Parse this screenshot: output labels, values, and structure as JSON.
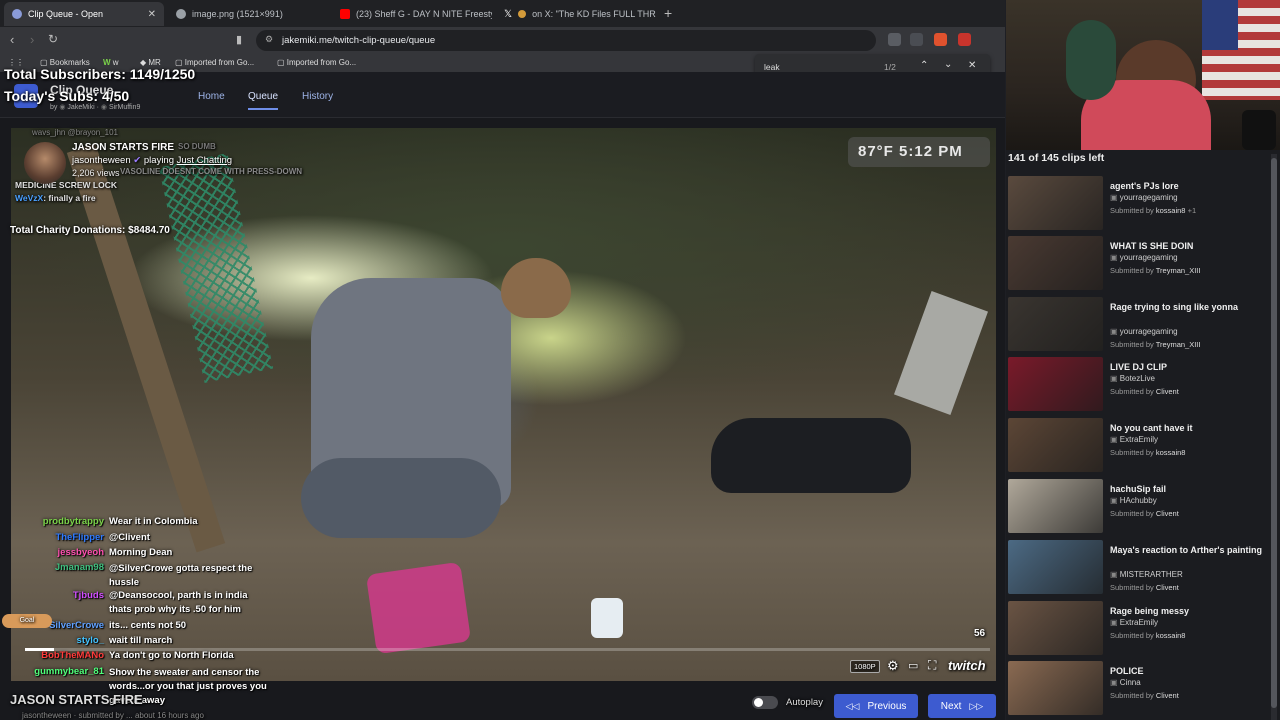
{
  "browser": {
    "tabs": [
      {
        "label": "Clip Queue - Open",
        "active": true
      },
      {
        "label": "image.png (1521×991)",
        "active": false
      },
      {
        "label": "(23) Sheff G - DAY N NITE Freestyle (",
        "active": false
      },
      {
        "label": "on X: \"The KD Files FULL THREAD",
        "active": false
      }
    ],
    "new_tab": "+",
    "url": "jakemiki.me/twitch-clip-queue/queue",
    "bookmarks": [
      "Bookmarks",
      "w",
      "MR",
      "Imported from Go...",
      "Imported from Go..."
    ],
    "find": {
      "query": "leak",
      "count": "1/2"
    }
  },
  "site": {
    "title": "Clip Queue",
    "by": "by",
    "author1": "JakeMiki",
    "author2": "SirMuffin9",
    "nav": [
      "Home",
      "Queue",
      "History"
    ],
    "active_nav": "Queue"
  },
  "stream_overlay": {
    "subs_total": "Total Subscribers: 1149/1250",
    "subs_today": "Today's Subs: 4/50",
    "weather": "87°F  5:12 PM",
    "charity": "Total Charity Donations: $8484.70",
    "top_chat": [
      {
        "user": "wavs_jhn",
        "text": "@brayon_101"
      },
      {
        "user": "",
        "text": "SO DUMB"
      },
      {
        "user": "",
        "text": "VASOLINE DOESNT COME WITH PRESS-DOWN"
      },
      {
        "user": "",
        "text": "MEDICINE SCREW LOCK"
      },
      {
        "user": "WeVzX",
        "text": "finally a fire"
      }
    ],
    "goal": "Goal"
  },
  "clip": {
    "title": "JASON STARTS FIRE",
    "channel": "jasontheween",
    "playing": "playing",
    "category": "Just Chatting",
    "views": "2,206 views",
    "progress": 0.03,
    "counter": "56",
    "quality": "1080P",
    "brand": "twitch",
    "bottom_title": "JASON STARTS FIRE",
    "bottom_meta": "jasontheween · submitted by ... about 16 hours ago"
  },
  "chat": [
    {
      "user": "prodbytrappy",
      "text": "Wear it in Colombia",
      "color": "#7bd34a"
    },
    {
      "user": "TheFlipper",
      "text": "@Clivent",
      "color": "#2f7bff"
    },
    {
      "user": "jessbyeoh",
      "text": "Morning Dean",
      "color": "#ff4fb0"
    },
    {
      "user": "Jmanam98",
      "text": "@SilverCrowe gotta respect the hussle",
      "color": "#3fbf7f"
    },
    {
      "user": "Tjbuds",
      "text": "@Deansocool, parth is in india",
      "color": "#d14fff"
    },
    {
      "user": "",
      "text": "thats prob why its .50 for him",
      "color": "#ffffff"
    },
    {
      "user": "SilverCrowe",
      "text": "its... cents not 50",
      "color": "#5fa0ff"
    },
    {
      "user": "stylo_",
      "text": "wait till march",
      "color": "#43c3ff"
    },
    {
      "user": "BobTheMANo",
      "text": "Ya don't go to North Florida",
      "color": "#ff3b3b"
    },
    {
      "user": "gummybear_81",
      "text": "Show the sweater and censor the words...or you that just proves you gave it away",
      "color": "#4fff7a"
    }
  ],
  "bottom": {
    "autoplay": "Autoplay",
    "previous": "Previous",
    "next": "Next"
  },
  "sidebar": {
    "count": "141 of 145 clips left",
    "clips": [
      {
        "title": "agent's PJs lore",
        "channel": "yourragegaming",
        "submitted": "Submitted by",
        "by": "kossain8",
        "extra": "+1",
        "thumb": "#5a4a3e"
      },
      {
        "title": "WHAT IS SHE DOIN",
        "channel": "yourragegaming",
        "submitted": "Submitted by",
        "by": "Treyman_XIII",
        "extra": "",
        "thumb": "#4a3a32"
      },
      {
        "title": "Rage trying to sing like yonna",
        "channel": "yourragegaming",
        "submitted": "Submitted by",
        "by": "Treyman_XIII",
        "extra": "",
        "thumb": "#3a3530"
      },
      {
        "title": "LIVE DJ CLIP",
        "channel": "BotezLive",
        "submitted": "Submitted by",
        "by": "Clivent",
        "extra": "",
        "thumb": "#7a1a2a"
      },
      {
        "title": "No you cant have it",
        "channel": "ExtraEmily",
        "submitted": "Submitted by",
        "by": "kossain8",
        "extra": "",
        "thumb": "#5c4636"
      },
      {
        "title": "hachuSip fail",
        "channel": "HAchubby",
        "submitted": "Submitted by",
        "by": "Clivent",
        "extra": "",
        "thumb": "#b0a89a"
      },
      {
        "title": "Maya's reaction to Arther's painting",
        "channel": "MISTERARTHER",
        "submitted": "Submitted by",
        "by": "Clivent",
        "extra": "",
        "thumb": "#4c6a84"
      },
      {
        "title": "Rage being messy",
        "channel": "ExtraEmily",
        "submitted": "Submitted by",
        "by": "kossain8",
        "extra": "",
        "thumb": "#6a5444"
      },
      {
        "title": "POLICE",
        "channel": "Cinna",
        "submitted": "Submitted by",
        "by": "Clivent",
        "extra": "",
        "thumb": "#8a6a52"
      }
    ]
  }
}
